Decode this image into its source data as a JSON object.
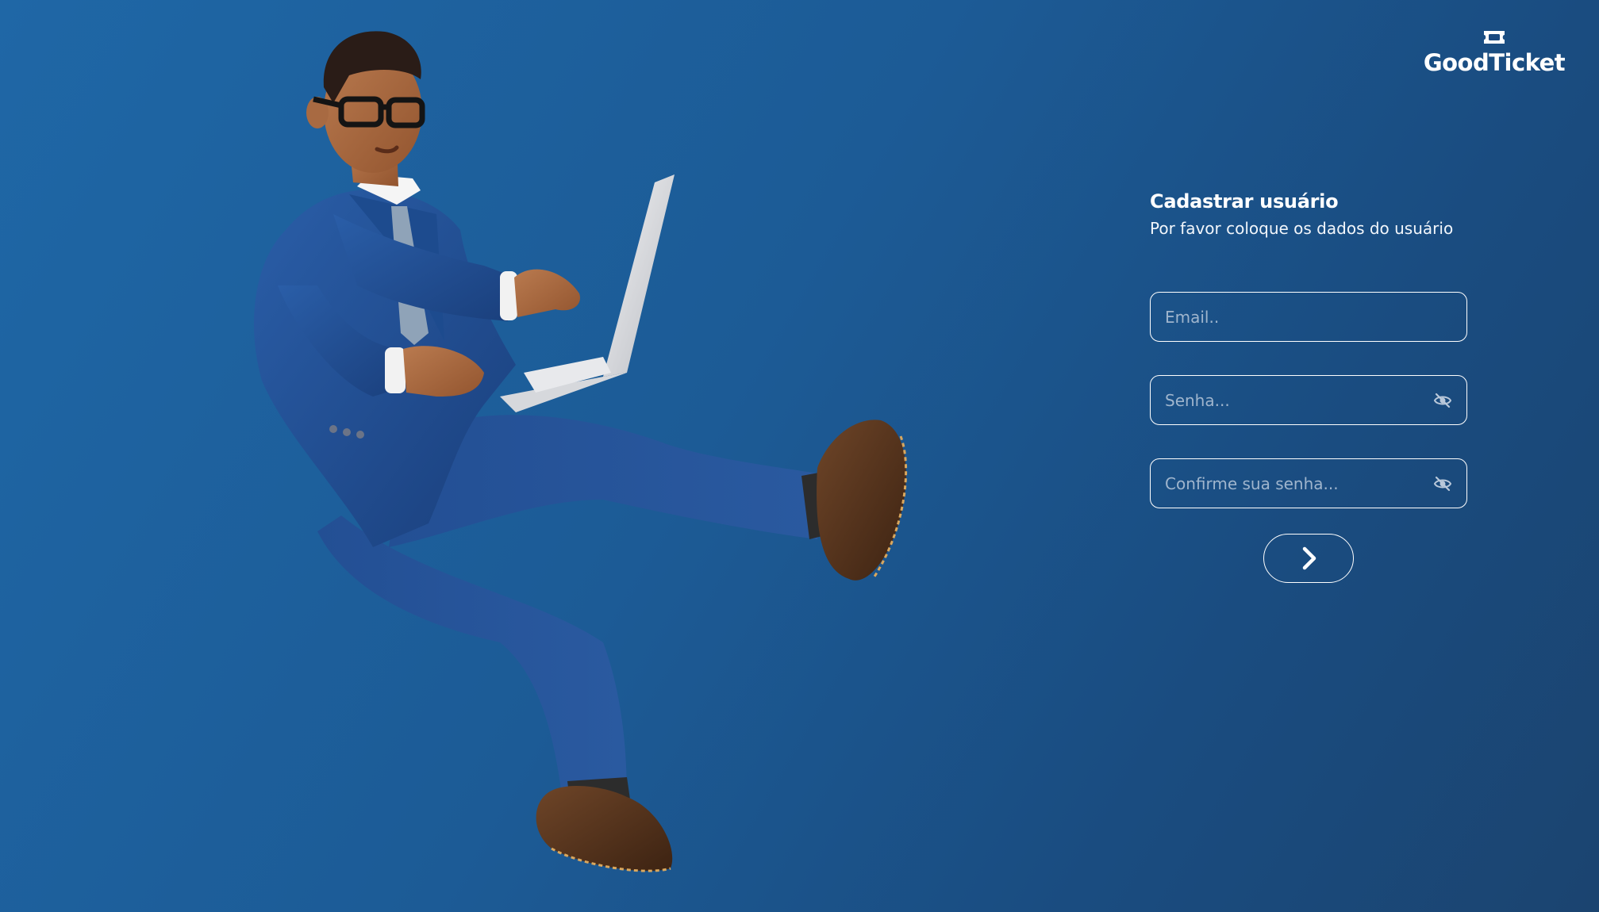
{
  "brand": {
    "name": "GoodTicket",
    "icon": "ticket-icon"
  },
  "form": {
    "title": "Cadastrar usuário",
    "subtitle": "Por favor coloque os dados do usuário",
    "email": {
      "placeholder": "Email..",
      "value": ""
    },
    "password": {
      "placeholder": "Senha...",
      "value": "",
      "toggle_icon": "eye-slash-icon"
    },
    "confirm_password": {
      "placeholder": "Confirme sua senha...",
      "value": "",
      "toggle_icon": "eye-slash-icon"
    },
    "submit_icon": "chevron-right-icon"
  },
  "illustration": {
    "subject": "3d-businessman-with-laptop"
  },
  "colors": {
    "background_start": "#1f67a6",
    "background_end": "#1b4470",
    "foreground": "#ffffff",
    "placeholder": "#9fb5cd",
    "suit": "#1f4f94",
    "skin": "#a8673f",
    "shoes": "#5a3620"
  }
}
